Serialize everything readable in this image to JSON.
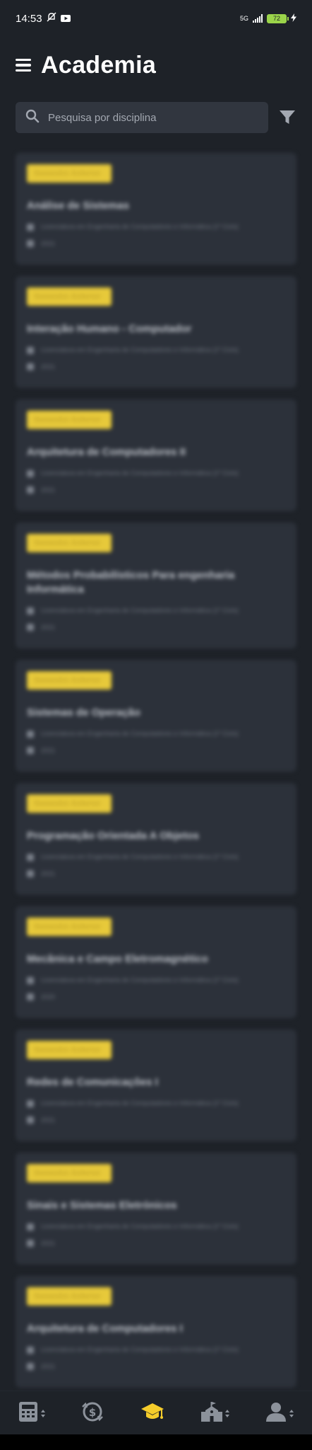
{
  "status_bar": {
    "time": "14:53",
    "network": "5G",
    "battery": "72"
  },
  "header": {
    "title": "Academia"
  },
  "search": {
    "placeholder": "Pesquisa por disciplina"
  },
  "courses": [
    {
      "badge": "Semestre Anterior",
      "name": "Análise de Sistemas",
      "program": "Licenciatura em Engenharia de Computadores e Informática (1º Ciclo)",
      "year": "2021"
    },
    {
      "badge": "Semestre Anterior",
      "name": "Interação Humano - Computador",
      "program": "Licenciatura em Engenharia de Computadores e Informática (1º Ciclo)",
      "year": "2021"
    },
    {
      "badge": "Semestre Anterior",
      "name": "Arquitetura de Computadores II",
      "program": "Licenciatura em Engenharia de Computadores e Informática (1º Ciclo)",
      "year": "2021"
    },
    {
      "badge": "Semestre Anterior",
      "name": "Métodos Probabilísticos Para engenharia Informática",
      "program": "Licenciatura em Engenharia de Computadores e Informática (1º Ciclo)",
      "year": "2021"
    },
    {
      "badge": "Semestre Anterior",
      "name": "Sistemas de Operação",
      "program": "Licenciatura em Engenharia de Computadores e Informática (1º Ciclo)",
      "year": "2021"
    },
    {
      "badge": "Semestre Anterior",
      "name": "Programação Orientada A Objetos",
      "program": "Licenciatura em Engenharia de Computadores e Informática (1º Ciclo)",
      "year": "2021"
    },
    {
      "badge": "Semestre Anterior",
      "name": "Mecânica e Campo Eletromagnético",
      "program": "Licenciatura em Engenharia de Computadores e Informática (1º Ciclo)",
      "year": "2020"
    },
    {
      "badge": "Semestre Anterior",
      "name": "Redes de Comunicações I",
      "program": "Licenciatura em Engenharia de Computadores e Informática (1º Ciclo)",
      "year": "2021"
    },
    {
      "badge": "Semestre Anterior",
      "name": "Sinais e Sistemas Eletrónicos",
      "program": "Licenciatura em Engenharia de Computadores e Informática (1º Ciclo)",
      "year": "2021"
    },
    {
      "badge": "Semestre Anterior",
      "name": "Arquitetura de Computadores I",
      "program": "Licenciatura em Engenharia de Computadores e Informática (1º Ciclo)",
      "year": "2021"
    }
  ],
  "bottom_nav": [
    {
      "icon": "calculator-icon"
    },
    {
      "icon": "money-icon"
    },
    {
      "icon": "graduation-cap-icon",
      "active": true,
      "color": "#f5cc2b"
    },
    {
      "icon": "school-icon"
    },
    {
      "icon": "user-icon"
    }
  ]
}
